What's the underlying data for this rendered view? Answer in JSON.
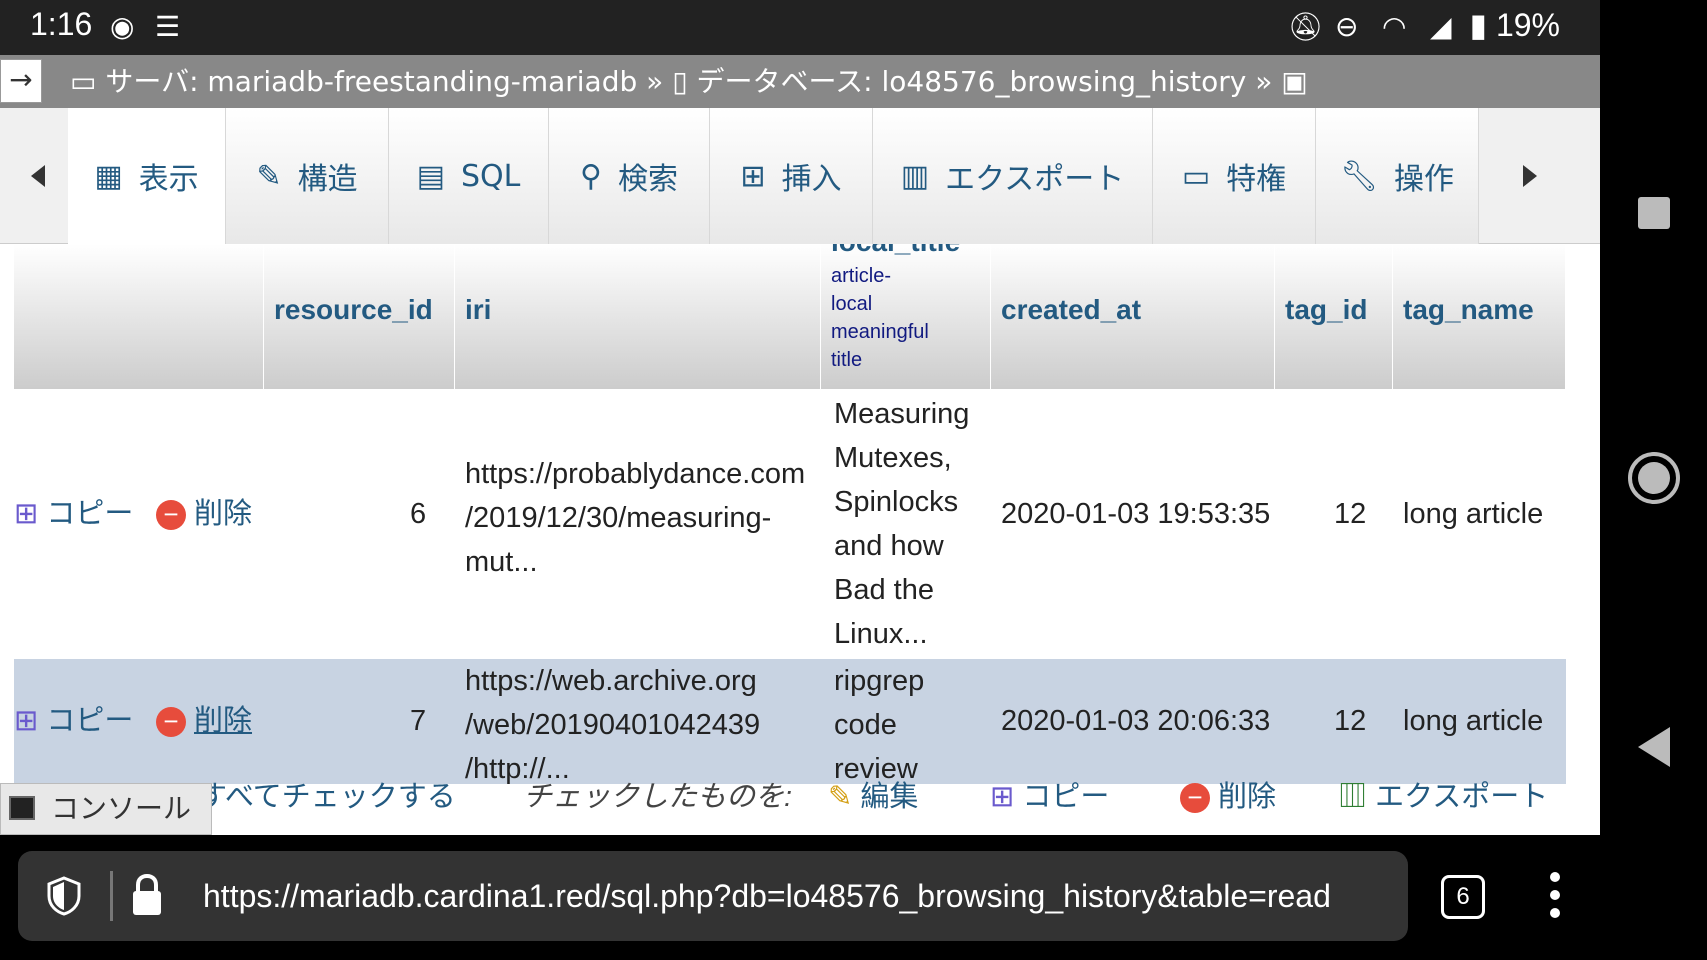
{
  "status_bar": {
    "time": "1:16",
    "battery": "19%",
    "icons": [
      "firefox-icon",
      "incognito-icon",
      "bell-off-icon",
      "dnd-icon",
      "wifi-icon",
      "signal-icon",
      "battery-icon"
    ]
  },
  "breadcrumb": {
    "collapse_glyph": "→",
    "server_label": "サーバ: mariadb-freestanding-mariadb",
    "sep1": "»",
    "database_label": "データベース: lo48576_browsing_history",
    "sep2": "»"
  },
  "tabs": [
    {
      "label": "表示",
      "icon": "table-icon"
    },
    {
      "label": "構造",
      "icon": "structure-icon"
    },
    {
      "label": "SQL",
      "icon": "sql-icon"
    },
    {
      "label": "検索",
      "icon": "search-icon"
    },
    {
      "label": "挿入",
      "icon": "insert-icon"
    },
    {
      "label": "エクスポート",
      "icon": "export-icon"
    },
    {
      "label": "特権",
      "icon": "privileges-icon"
    },
    {
      "label": "操作",
      "icon": "wrench-icon"
    }
  ],
  "table": {
    "columns": {
      "resource_id": "resource_id",
      "iri": "iri",
      "local_title": "local_title",
      "local_title_comment_1": "article-",
      "local_title_comment_2": "local",
      "local_title_comment_3": "meaningful",
      "local_title_comment_4": "title",
      "created_at": "created_at",
      "tag_id": "tag_id",
      "tag_name": "tag_name"
    },
    "rows": [
      {
        "copy": "コピー",
        "delete": "削除",
        "resource_id": "6",
        "iri_1": "https://probablydance.com",
        "iri_2": "/2019/12/30/measuring-",
        "iri_3": "mut...",
        "title_1": "Measuring",
        "title_2": "Mutexes,",
        "title_3": "Spinlocks",
        "title_4": "and how",
        "title_5": "Bad the",
        "title_6": "Linux...",
        "created_at": "2020-01-03 19:53:35",
        "tag_id": "12",
        "tag_name": "long article"
      },
      {
        "copy": "コピー",
        "delete": "削除",
        "resource_id": "7",
        "iri_1": "https://web.archive.org",
        "iri_2": "/web/20190401042439",
        "iri_3": "/http://...",
        "title_1": "ripgrep",
        "title_2": "code",
        "title_3": "review",
        "created_at": "2020-01-03 20:06:33",
        "tag_id": "12",
        "tag_name": "long article"
      }
    ]
  },
  "bulk": {
    "check_all": "すべてチェックする",
    "with_selected": "チェックしたものを:",
    "edit": "編集",
    "copy": "コピー",
    "delete": "削除",
    "export": "エクスポート"
  },
  "console": {
    "label": "コンソール"
  },
  "url_bar": {
    "url": "https://mariadb.cardina1.red/sql.php?db=lo48576_browsing_history&table=read",
    "tab_count": "6"
  },
  "colors": {
    "link": "#235a81",
    "selected_row": "#c8d3e2",
    "breadcrumb_bg": "#888888"
  }
}
